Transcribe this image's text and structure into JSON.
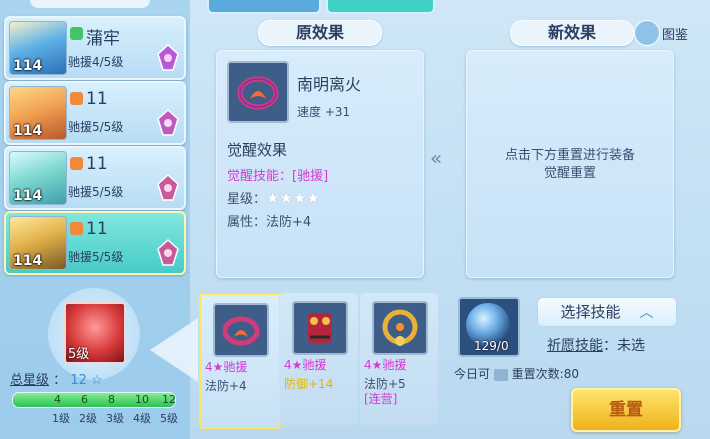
{
  "left_panel": {
    "heroes": [
      {
        "name": "蒲牢",
        "level": "114",
        "sub": "驰援4/5级",
        "badge_color": "#42c46a",
        "selected": false
      },
      {
        "name": "11",
        "level": "114",
        "sub": "驰援5/5级",
        "badge_color": "#f08a3a",
        "selected": false
      },
      {
        "name": "11",
        "level": "114",
        "sub": "驰援5/5级",
        "badge_color": "#f08a3a",
        "selected": false
      },
      {
        "name": "11",
        "level": "114",
        "sub": "驰援5/5级",
        "badge_color": "#f08a3a",
        "selected": true
      }
    ],
    "skill_level": "5级",
    "total_star_label": "总星级",
    "total_star_value": "12",
    "star_symbol": "☆",
    "progress_fraction": 1.0,
    "progress_ticks": [
      "4",
      "6",
      "8",
      "10",
      "12"
    ],
    "level_labels": [
      "1级",
      "2级",
      "3级",
      "4级",
      "5级"
    ]
  },
  "original_effect": {
    "header": "原效果",
    "item_name": "南明离火",
    "item_stat": "速度 +31",
    "awaken_title": "觉醒效果",
    "awaken_skill_label": "觉醒技能：",
    "awaken_skill_value": "[驰援]",
    "star_label": "星级：",
    "stars": "★★★★",
    "attr_label": "属性：",
    "attr_value": "法防+4"
  },
  "new_effect": {
    "header": "新效果",
    "codex_label": "图鉴",
    "placeholder_line1": "点击下方重置进行装备",
    "placeholder_line2": "觉醒重置"
  },
  "equipment_slots": [
    {
      "tag": "4★驰援",
      "stat": "法防+4",
      "stat_color": "#3b4f70",
      "extra": "",
      "selected": true
    },
    {
      "tag": "4★驰援",
      "stat": "防御+14",
      "stat_color": "#e0b800",
      "extra": "",
      "selected": false
    },
    {
      "tag": "4★驰援",
      "stat": "法防+5",
      "stat_color": "#3b4f70",
      "extra": "[连营]",
      "selected": false
    }
  ],
  "reset_panel": {
    "orb_count": "129/0",
    "choose_skill_label": "选择技能",
    "wish_skill_label": "祈愿技能",
    "wish_skill_sep": "：",
    "wish_skill_value": "未选",
    "today_label": "今日可",
    "reset_count_label": "重置次数:",
    "reset_count_value": "80",
    "reset_button": "重置"
  }
}
